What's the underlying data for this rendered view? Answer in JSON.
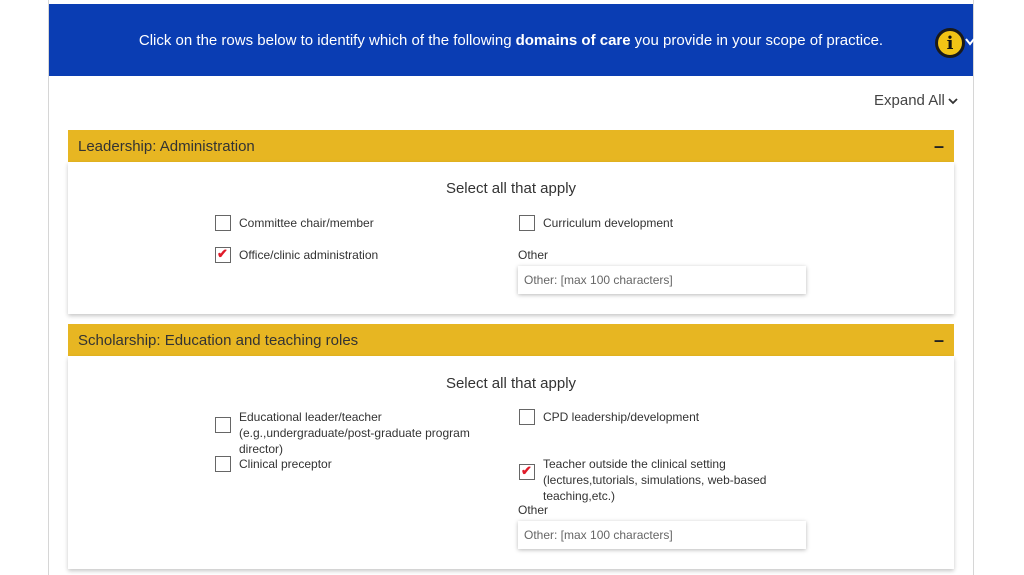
{
  "banner": {
    "text_before": "Click on the rows below to identify which of the following",
    "text_bold": "domains of care",
    "text_after": "you provide in your scope of practice.",
    "info_icon_glyph": "i",
    "background_color": "#0a3db3"
  },
  "expand_all_label": "Expand All",
  "sections": [
    {
      "title": "Leadership: Administration",
      "collapse_glyph": "–",
      "select_title": "Select all that apply",
      "options": [
        {
          "label": "Committee chair/member",
          "checked": false
        },
        {
          "label": "Curriculum development",
          "checked": false
        },
        {
          "label": "Office/clinic administration",
          "checked": true
        }
      ],
      "other_label": "Other",
      "other_placeholder": "Other: [max 100 characters]"
    },
    {
      "title": "Scholarship: Education and teaching roles",
      "collapse_glyph": "–",
      "select_title": "Select all that apply",
      "options": [
        {
          "label": "Educational leader/teacher (e.g.,undergraduate/post-graduate program director)",
          "checked": false
        },
        {
          "label": "CPD leadership/development",
          "checked": false
        },
        {
          "label": "Clinical preceptor",
          "checked": false
        },
        {
          "label": "Teacher outside the clinical setting (lectures,tutorials, simulations, web-based teaching,etc.)",
          "checked": true
        }
      ],
      "other_label": "Other",
      "other_placeholder": "Other: [max 100 characters]"
    }
  ],
  "colors": {
    "section_header": "#e7b622",
    "check_mark": "#e01b2a",
    "info_button": "#f2c315"
  },
  "icons": {
    "check": "✔",
    "chevron": "chevron-down-icon"
  }
}
